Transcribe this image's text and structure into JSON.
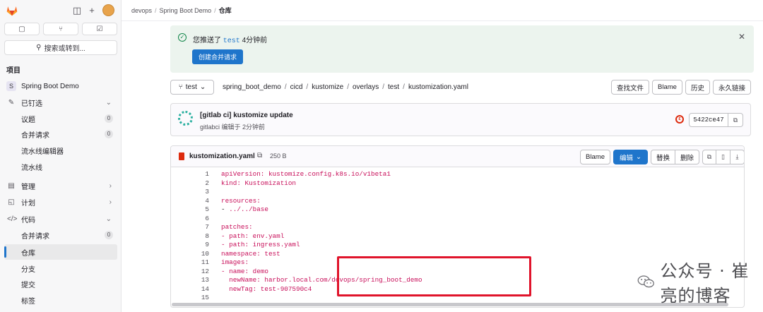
{
  "breadcrumb": [
    "devops",
    "Spring Boot Demo",
    "仓库"
  ],
  "sidebar": {
    "search_label": "搜索或转到...",
    "section_title": "项目",
    "project_initial": "S",
    "project_name": "Spring Boot Demo",
    "pinned_label": "已钉选",
    "items": [
      {
        "label": "议题",
        "count": "0"
      },
      {
        "label": "合并请求",
        "count": "0"
      },
      {
        "label": "流水线编辑器"
      },
      {
        "label": "流水线"
      },
      {
        "label": "管理"
      },
      {
        "label": "计划"
      },
      {
        "label": "代码"
      },
      {
        "label": "合并请求",
        "count": "0"
      },
      {
        "label": "仓库"
      },
      {
        "label": "分支"
      },
      {
        "label": "提交"
      },
      {
        "label": "标签"
      }
    ]
  },
  "alert": {
    "prefix": "您推送了",
    "branch": "test",
    "suffix": "4分钟前",
    "button": "创建合并请求"
  },
  "repo": {
    "branch": "test",
    "path": [
      "spring_boot_demo",
      "cicd",
      "kustomize",
      "overlays",
      "test",
      "kustomization.yaml"
    ],
    "buttons": [
      "查找文件",
      "Blame",
      "历史",
      "永久链接"
    ]
  },
  "commit": {
    "title": "[gitlab ci] kustomize update",
    "author": "gitlabci",
    "meta": "编辑于 2分钟前",
    "pipeline_symbol": "ε",
    "sha": "5422ce47"
  },
  "file": {
    "name": "kustomization.yaml",
    "size": "250 B",
    "blame": "Blame",
    "edit": "编辑",
    "replace": "替换",
    "delete": "删除"
  },
  "code_lines": [
    {
      "n": "1",
      "k": "apiVersion:",
      "v": " kustomize.config.k8s.io/v1beta1"
    },
    {
      "n": "2",
      "k": "kind:",
      "v": " Kustomization"
    },
    {
      "n": "3",
      "k": "",
      "v": ""
    },
    {
      "n": "4",
      "k": "resources:",
      "v": ""
    },
    {
      "n": "5",
      "k": "- ",
      "v": "../../base"
    },
    {
      "n": "6",
      "k": "",
      "v": ""
    },
    {
      "n": "7",
      "k": "patches:",
      "v": ""
    },
    {
      "n": "8",
      "k": "- path:",
      "v": " env.yaml"
    },
    {
      "n": "9",
      "k": "- path:",
      "v": " ingress.yaml"
    },
    {
      "n": "10",
      "k": "namespace:",
      "v": " test"
    },
    {
      "n": "11",
      "k": "images:",
      "v": ""
    },
    {
      "n": "12",
      "k": "- name:",
      "v": " demo"
    },
    {
      "n": "13",
      "k": "  newName:",
      "v": " harbor.local.com/devops/spring_boot_demo"
    },
    {
      "n": "14",
      "k": "  newTag:",
      "v": " test-907590c4"
    },
    {
      "n": "15",
      "k": "",
      "v": ""
    }
  ],
  "watermark": "公众号 · 崔亮的博客",
  "colors": {
    "primary": "#1f75cb",
    "highlight": "#e0142b",
    "alert_bg": "#ecf4ee",
    "code_key": "#c80f5a"
  }
}
